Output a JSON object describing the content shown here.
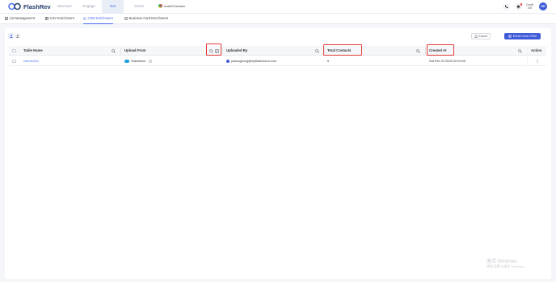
{
  "app": {
    "name": "FlashRev"
  },
  "nav": {
    "tabs": [
      "Discover",
      "Engage",
      "Get",
      "Intent"
    ],
    "active": "Get"
  },
  "install": {
    "label": "Install Extension"
  },
  "header": {
    "credit_line1": "Credit",
    "credit_line2": "200",
    "avatar": "HD"
  },
  "subtabs": {
    "items": [
      "List Management",
      "CSV Enrichment",
      "CRM Enrichment",
      "Business Card Enrichment"
    ],
    "active": "CRM Enrichment"
  },
  "toolbar": {
    "export_label": "Export",
    "enrich_label": "Enrich from CRM"
  },
  "table": {
    "columns": [
      "Table Name",
      "Upload From",
      "Uploaded By",
      "Total Contacts",
      "Created At",
      "Action"
    ],
    "rows": [
      {
        "table_name": "chenxu001",
        "upload_from": "Salesforce",
        "uploaded_by": "yukongkong@myflashcloud.com",
        "total_contacts": "6",
        "created_at": "Sat Feb 22 2025 02:03:00",
        "action": "⋮"
      }
    ]
  },
  "watermark": {
    "line1": "激活 Windows",
    "line2": "转到“设置”以激活 Windows。"
  },
  "colors": {
    "accent": "#4a6cf7",
    "primary_button": "#3f5bd8",
    "highlight": "#e53935"
  }
}
